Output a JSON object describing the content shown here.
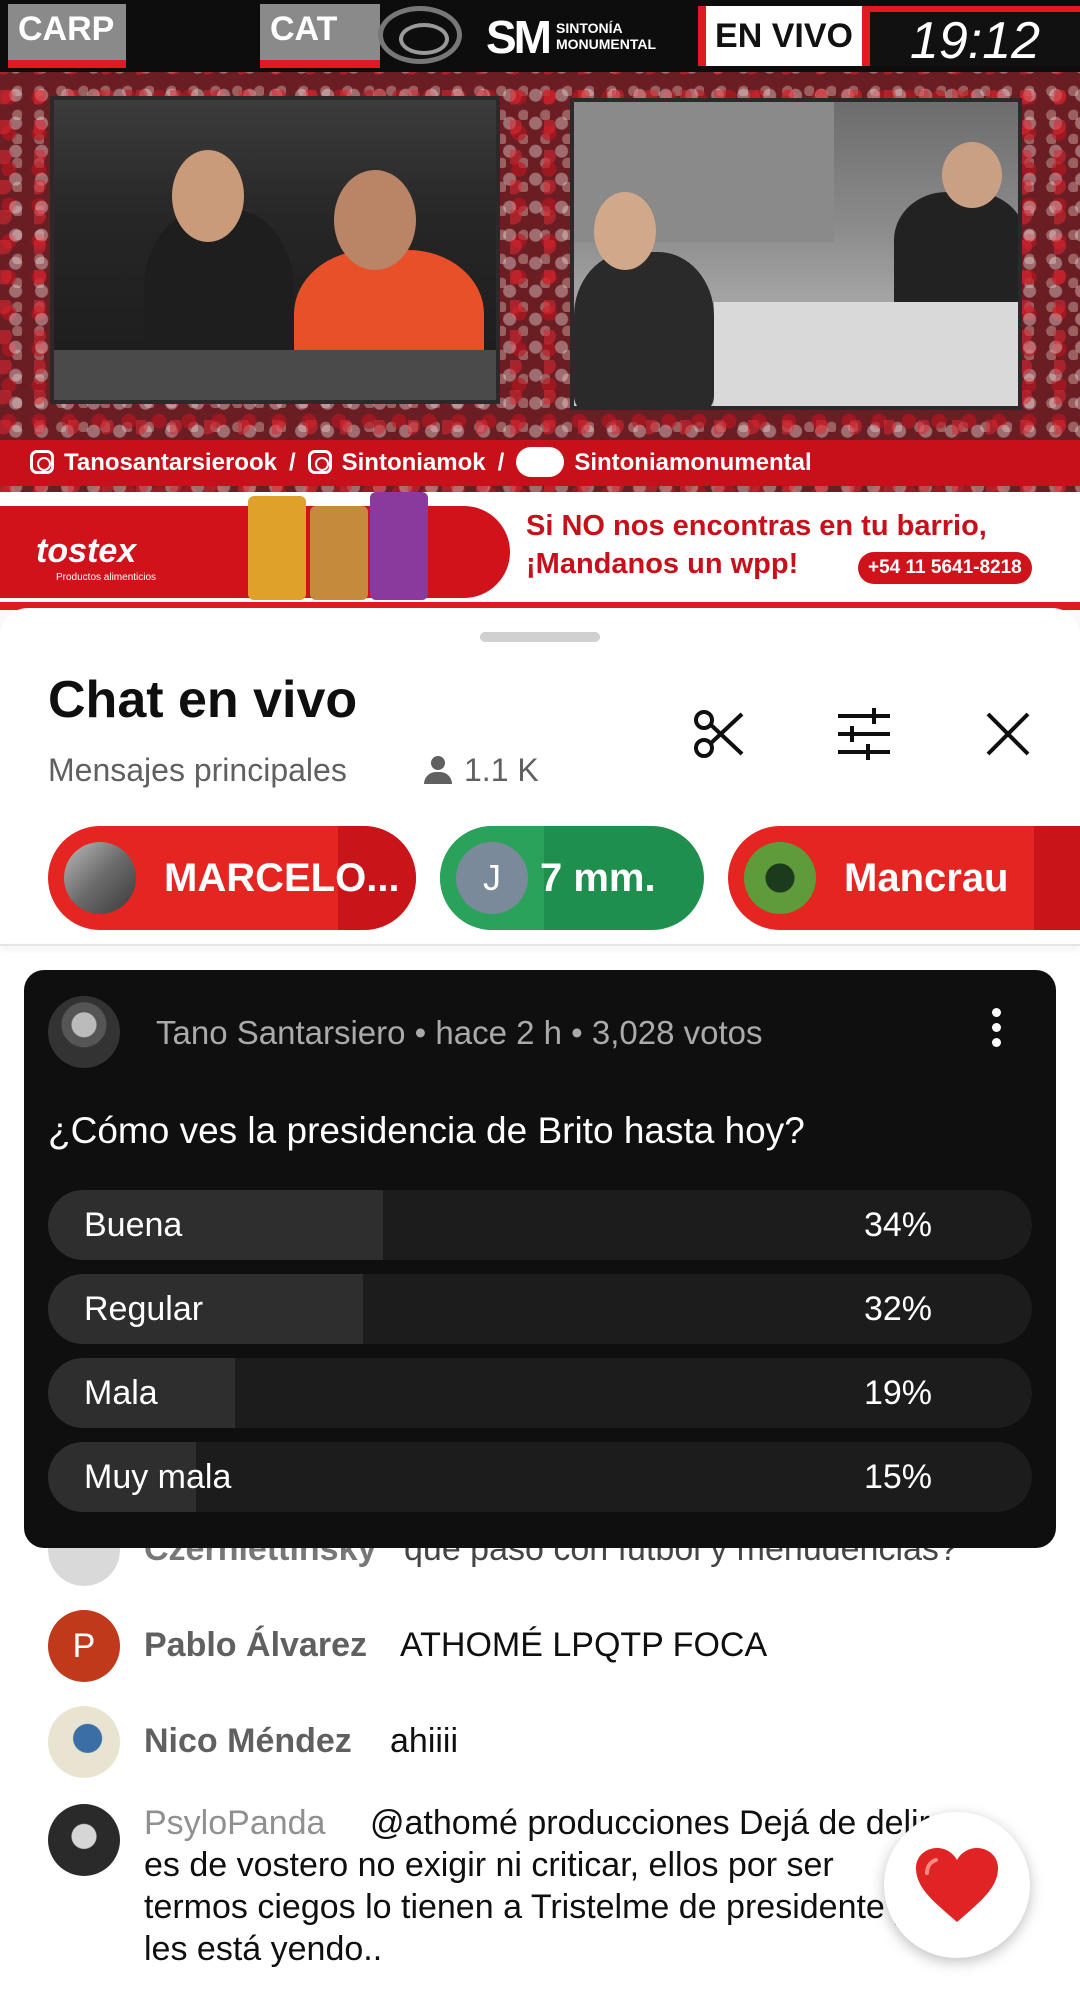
{
  "video": {
    "tags": {
      "carp": "CARP",
      "cat": "CAT"
    },
    "station": {
      "logo": "SM",
      "name_line1": "SINTONÍA",
      "name_line2": "MONUMENTAL"
    },
    "live_badge": "EN VIVO",
    "clock": "19:12",
    "social": {
      "instagram_1": "Tanosantarsierook",
      "instagram_2": "Sintoniamok",
      "handshake": "Sintoniamonumental",
      "separator": "/"
    },
    "ad": {
      "brand": "tostex",
      "brand_sub": "Productos alimenticios",
      "line1": "Si NO nos encontras en tu barrio,",
      "line2": "¡Mandanos un wpp!",
      "phone": "+54 11 5641-8218"
    }
  },
  "chat": {
    "title": "Chat en vivo",
    "mode": "Mensajes principales",
    "viewers": "1.1 K",
    "icons": [
      "scissors-icon",
      "tune-icon",
      "close-icon"
    ],
    "chips": [
      {
        "label": "MARCELO...",
        "color": "#e52521"
      },
      {
        "label": "7 mm.",
        "initial": "J",
        "color": "#1f8f4e"
      },
      {
        "label": "Mancrau",
        "color": "#e52521"
      }
    ],
    "poll": {
      "author": "Tano Santarsiero",
      "time": "hace 2 h",
      "votes": "3,028 votos",
      "meta": "Tano Santarsiero • hace 2 h • 3,028 votos",
      "question": "¿Cómo ves la presidencia de Brito hasta hoy?",
      "options": [
        {
          "label": "Buena",
          "percent_text": "34%",
          "percent": 34
        },
        {
          "label": "Regular",
          "percent_text": "32%",
          "percent": 32
        },
        {
          "label": "Mala",
          "percent_text": "19%",
          "percent": 19
        },
        {
          "label": "Muy mala",
          "percent_text": "15%",
          "percent": 15
        }
      ]
    },
    "messages": [
      {
        "author": "Czerniettinsky",
        "text": "que pasó con futbol y menudencias?"
      },
      {
        "author": "Pablo Álvarez",
        "initial": "P",
        "avatar_color": "#c0391b",
        "text": "ATHOMÉ LPQTP FOCA"
      },
      {
        "author": "Nico Méndez",
        "text": "ahiiii"
      },
      {
        "author": "PsyloPanda",
        "lines": [
          "@athomé producciones Dejá de delirar",
          "es de vostero no exigir ni criticar, ellos por ser",
          "termos ciegos lo tienen a Tristelme de presidente y así",
          "les está yendo.."
        ]
      }
    ]
  }
}
